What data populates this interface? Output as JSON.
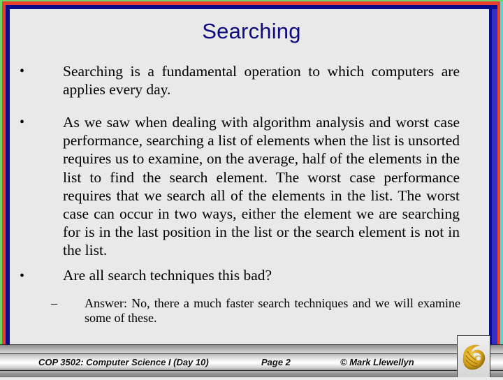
{
  "slide": {
    "title": "Searching",
    "bullets": [
      {
        "marker": "•",
        "text": "Searching is a fundamental operation to which computers are applies every day."
      },
      {
        "marker": "•",
        "text": "As we saw when dealing with algorithm analysis and worst case performance, searching a list of elements when the list is unsorted requires us to examine, on the average, half of the elements in the list to find the search element.  The worst case performance requires that we search all of the elements in the list.  The worst case can occur in two ways, either the element we are searching for is in the last position in the list or the search element is not in the list."
      },
      {
        "marker": "•",
        "text": "Are all search techniques this bad?",
        "sub": {
          "marker": "–",
          "text": "Answer:  No, there a much faster search techniques and we will examine some of these."
        }
      }
    ]
  },
  "footer": {
    "course": "COP 3502: Computer Science I  (Day 10)",
    "page": "Page 2",
    "copyright": "© Mark Llewellyn",
    "logo_icon": "pegasus-logo-icon"
  },
  "colors": {
    "title": "#0c0c80",
    "frame_green": "#6fd36a",
    "frame_red": "#e8402c",
    "frame_navy": "#0a0a8c",
    "frame_blue": "#2f2fc8",
    "logo_gold": "#d4a017"
  }
}
